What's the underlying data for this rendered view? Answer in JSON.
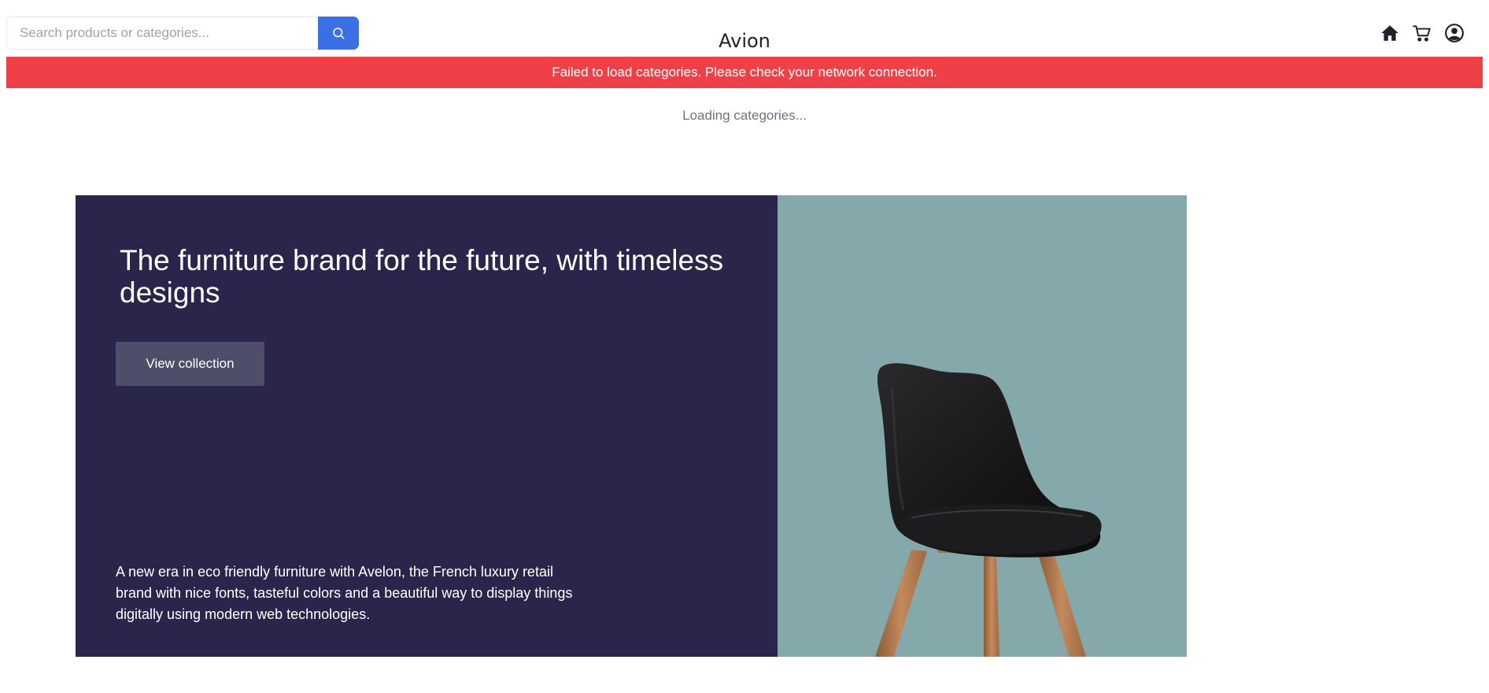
{
  "search": {
    "placeholder": "Search products or categories...",
    "value": ""
  },
  "header": {
    "brand": "Avion",
    "icons": [
      "home-icon",
      "cart-icon",
      "user-account-icon",
      "search-icon"
    ]
  },
  "alert": {
    "message": "Failed to load categories. Please check your network connection.",
    "color": "#ef4048"
  },
  "categories": {
    "status_text": "Loading categories..."
  },
  "hero": {
    "title": "The furniture brand for the future, with timeless designs",
    "button_label": "View collection",
    "description": "A new era in eco friendly furniture with Avelon, the French luxury retail brand with nice fonts, tasteful colors and a beautiful way to display things digitally using modern web technologies.",
    "image": "chair-image",
    "left_color": "#2a254b",
    "right_color": "#85a8ab"
  },
  "colors": {
    "primary": "#3b6fe6",
    "brand_text": "#22202e",
    "button": "#4e4d6a"
  }
}
